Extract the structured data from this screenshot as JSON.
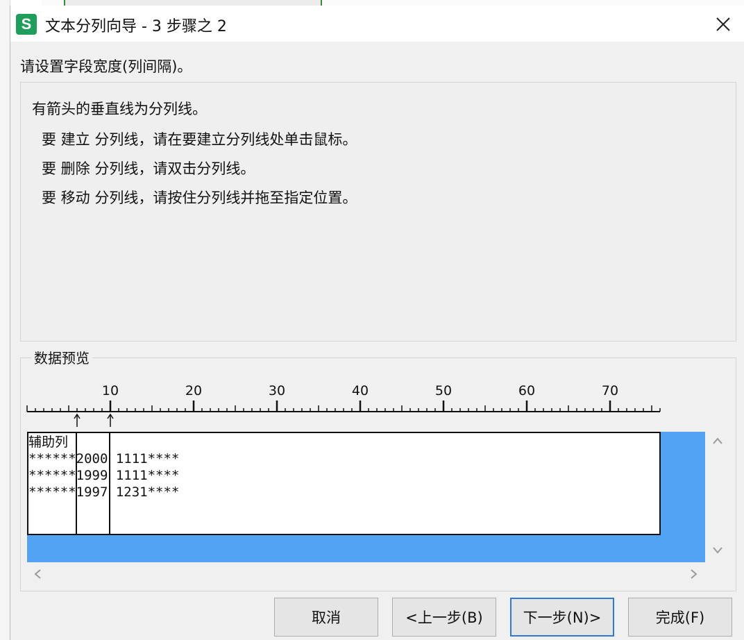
{
  "window": {
    "app_icon_letter": "S",
    "title": "文本分列向导 - 3 步骤之 2"
  },
  "instruction": "请设置字段宽度(列间隔)。",
  "info": {
    "line1": "有箭头的垂直线为分列线。",
    "line2": "要 建立 分列线，请在要建立分列线处单击鼠标。",
    "line3": "要 删除 分列线，请双击分列线。",
    "line4": "要 移动 分列线，请按住分列线并拖至指定位置。"
  },
  "preview": {
    "label": "数据预览",
    "ruler_labels": [
      "10",
      "20",
      "30",
      "40",
      "50",
      "60",
      "70"
    ],
    "break_positions": [
      6,
      10
    ],
    "rows": [
      "辅助列",
      "******2000 1111****",
      "******1999 1111****",
      "******1997 1231****"
    ]
  },
  "buttons": {
    "cancel": "取消",
    "back": "<上一步(B)",
    "next": "下一步(N)>",
    "finish": "完成(F)"
  },
  "colors": {
    "app_icon": "#1e9e5a",
    "preview_highlight": "#53a3f5",
    "default_button_border": "#2e7bd1"
  }
}
